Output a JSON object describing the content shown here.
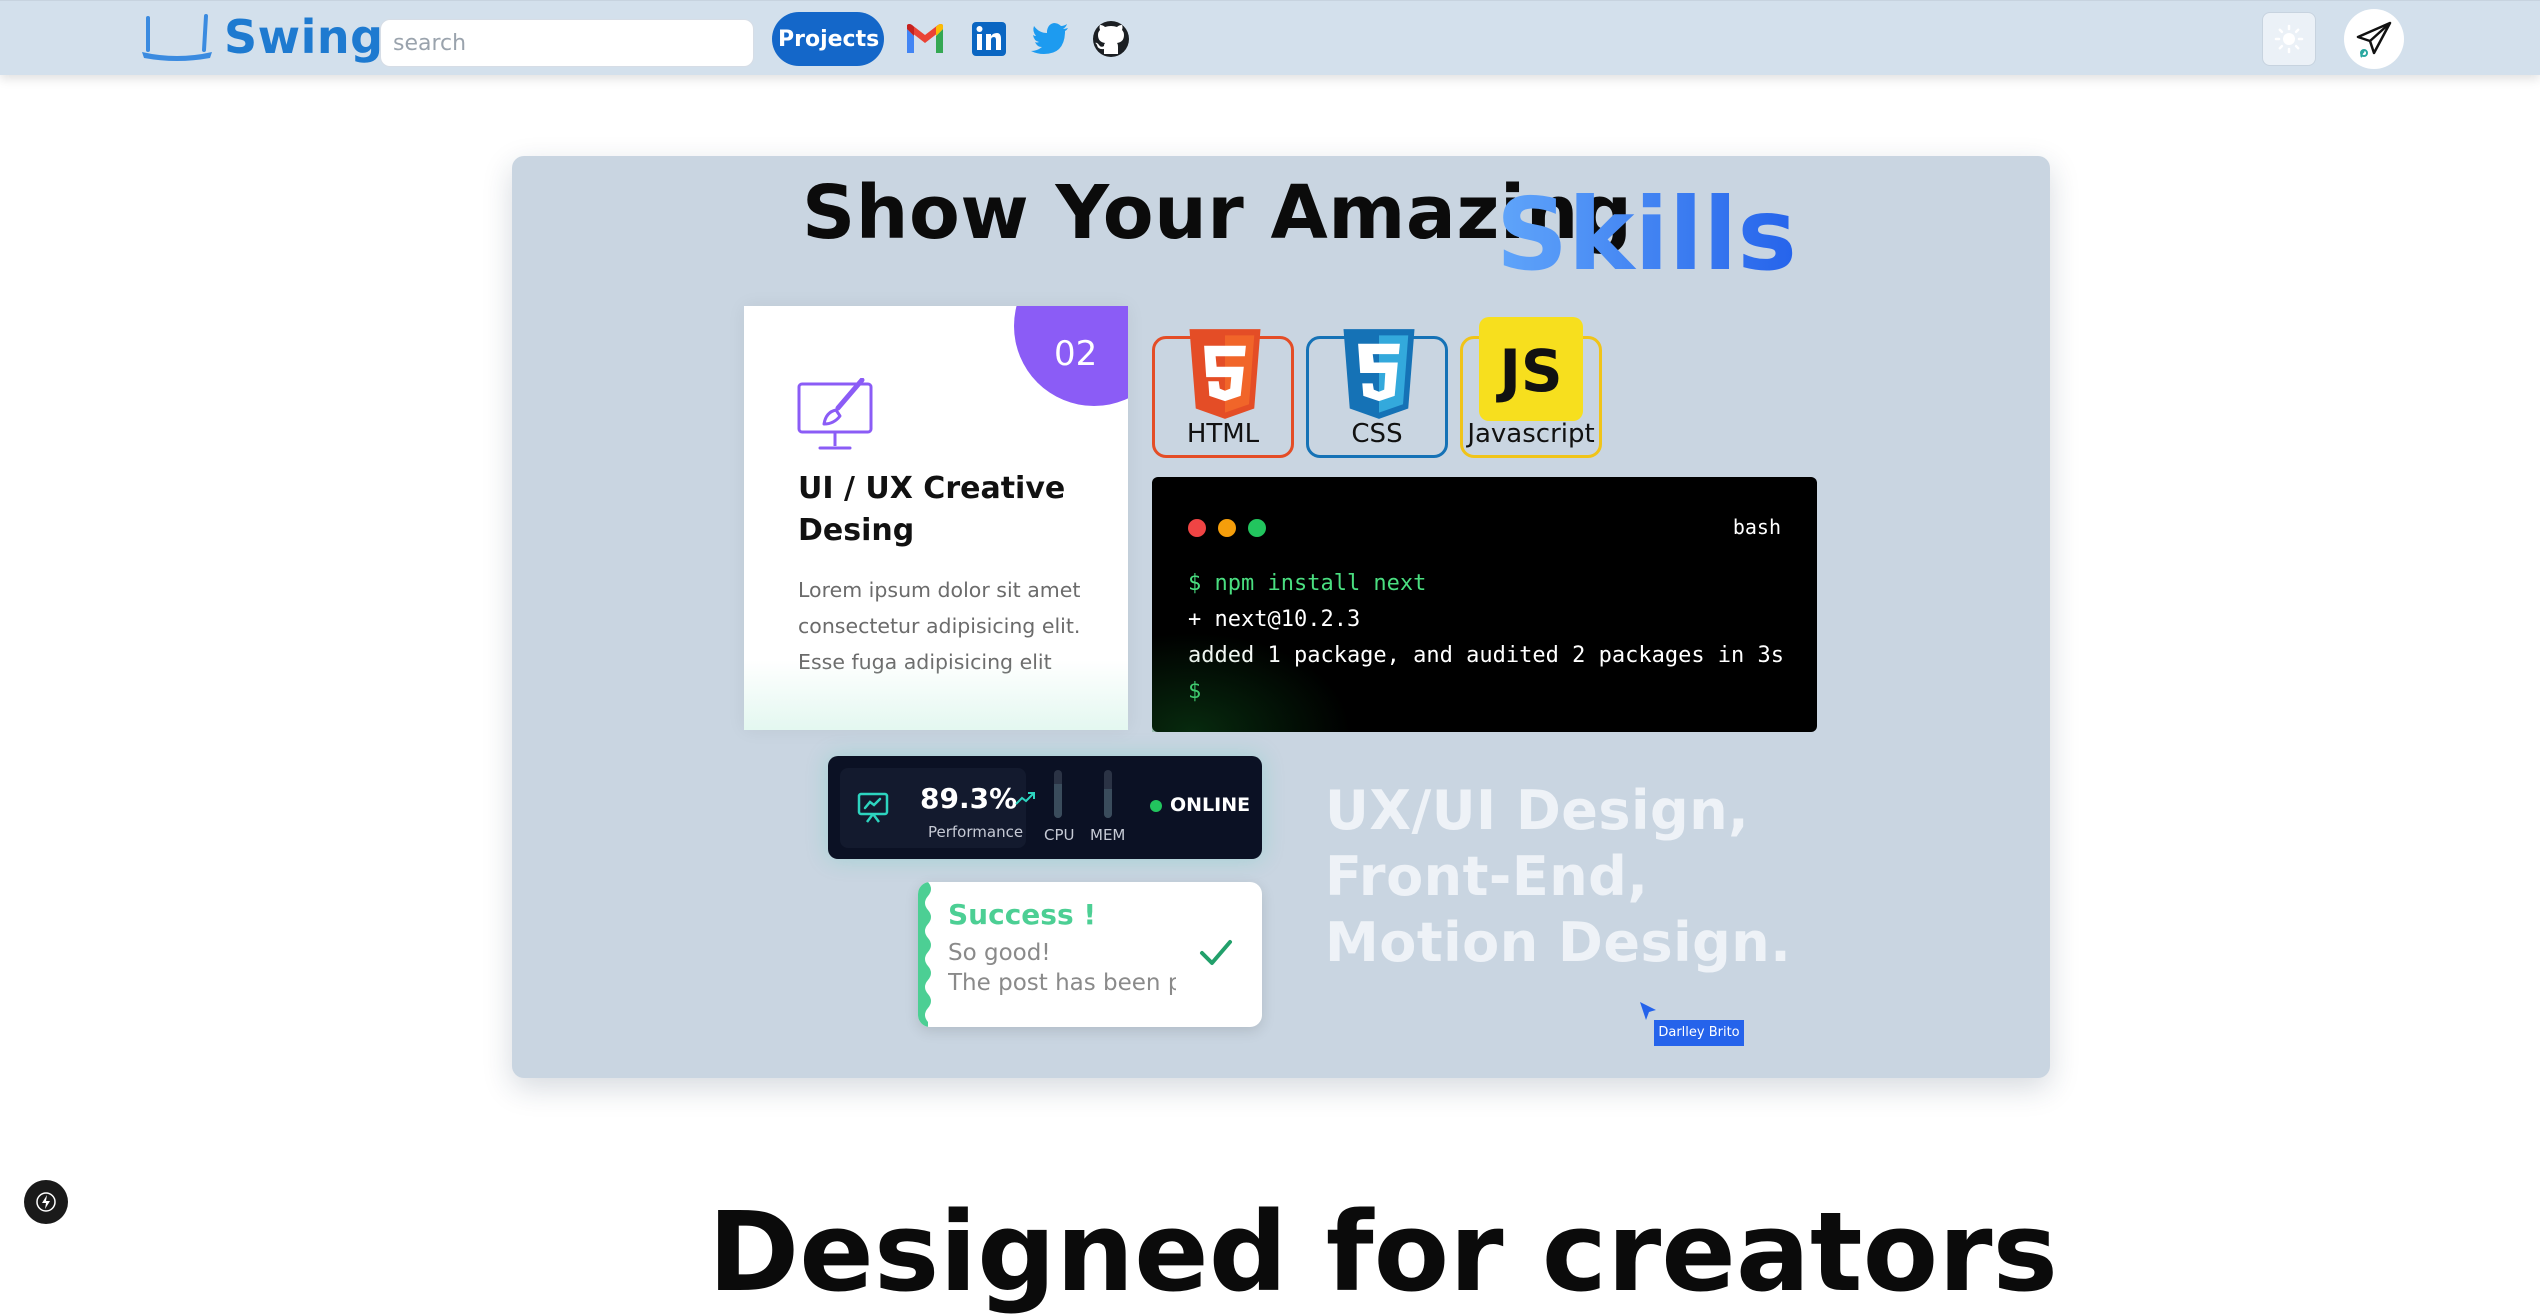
{
  "navbar": {
    "brand": "Swing",
    "search_placeholder": "search",
    "projects_label": "Projects",
    "social_icons": [
      "gmail-icon",
      "linkedin-icon",
      "twitter-icon",
      "github-icon"
    ],
    "theme_icon": "sun-icon",
    "avatar_icon": "paper-plane-icon"
  },
  "hero": {
    "title_main": "Show Your Amazing",
    "title_accent": "Skills",
    "accent_colors": [
      "#60a5fa",
      "#2563eb"
    ]
  },
  "service_card": {
    "number": "02",
    "icon": "monitor-brush-icon",
    "title": "UI / UX Creative Desing",
    "description": "Lorem ipsum dolor sit amet consectetur adipisicing elit. Esse fuga adipisicing elit",
    "accent_color": "#8b5cf6"
  },
  "tech_badges": [
    {
      "label": "HTML",
      "icon": "html5-icon",
      "color": "#e44d26"
    },
    {
      "label": "CSS",
      "icon": "css3-icon",
      "color": "#1572b6"
    },
    {
      "label": "Javascript",
      "icon": "js-icon",
      "color": "#f0db4f"
    }
  ],
  "terminal": {
    "tag": "bash",
    "lines": [
      {
        "text": "$ npm install next",
        "color": "#4ade80"
      },
      {
        "text": "+ next@10.2.3",
        "color": "#ffffff"
      },
      {
        "text": "added 1 package, and audited 2 packages in 3s",
        "color": "#ffffff"
      },
      {
        "text": "$",
        "color": "#4ade80"
      }
    ]
  },
  "performance": {
    "value": "89.3%",
    "label": "Performance",
    "cpu_label": "CPU",
    "mem_label": "MEM",
    "status": "ONLINE"
  },
  "toast": {
    "title": "Success !",
    "line1": "So good!",
    "line2": "The post has been pu"
  },
  "roles": [
    "UX/UI Design,",
    "Front-End,",
    "Motion Design."
  ],
  "cursor_tag": "Darlley Brito",
  "bottom_heading": "Designed for creators"
}
